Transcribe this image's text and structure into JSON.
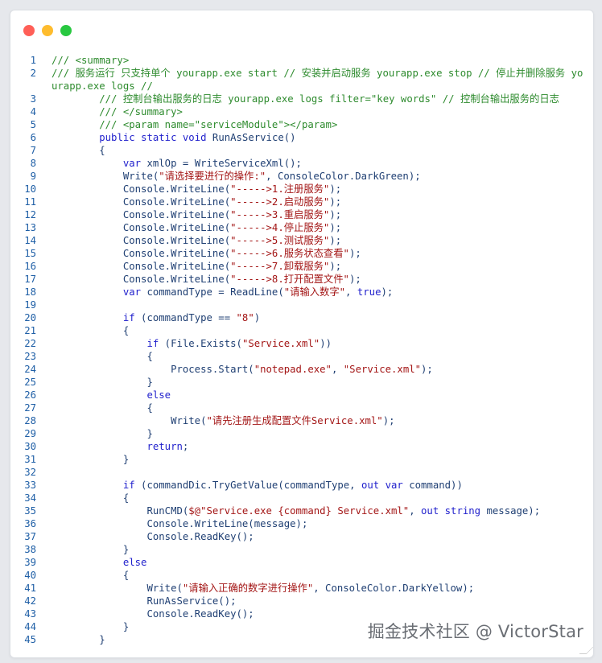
{
  "window": {
    "traffic_lights": [
      {
        "name": "close",
        "color": "#ff5f57"
      },
      {
        "name": "minimize",
        "color": "#febc2e"
      },
      {
        "name": "maximize",
        "color": "#28c840"
      }
    ]
  },
  "code": {
    "lines": [
      {
        "n": "1",
        "text": "/// <summary>"
      },
      {
        "n": "2",
        "text": "        /// 服务运行 只支持单个 yourapp.exe start // 安装并启动服务 yourapp.exe stop // 停止并删除服务 yourapp.exe logs //",
        "wrap": true
      },
      {
        "n": "3",
        "text": "        /// 控制台输出服务的日志 yourapp.exe logs filter=\"key words\" // 控制台输出服务的日志"
      },
      {
        "n": "4",
        "text": "        /// </summary>"
      },
      {
        "n": "5",
        "text": "        /// <param name=\"serviceModule\"></param>"
      },
      {
        "n": "6",
        "text": "        public static void RunAsService()"
      },
      {
        "n": "7",
        "text": "        {"
      },
      {
        "n": "8",
        "text": "            var xmlOp = WriteServiceXml();"
      },
      {
        "n": "9",
        "text": "            Write(\"请选择要进行的操作:\", ConsoleColor.DarkGreen);"
      },
      {
        "n": "10",
        "text": "            Console.WriteLine(\"----->1.注册服务\");"
      },
      {
        "n": "11",
        "text": "            Console.WriteLine(\"----->2.启动服务\");"
      },
      {
        "n": "12",
        "text": "            Console.WriteLine(\"----->3.重启服务\");"
      },
      {
        "n": "13",
        "text": "            Console.WriteLine(\"----->4.停止服务\");"
      },
      {
        "n": "14",
        "text": "            Console.WriteLine(\"----->5.测试服务\");"
      },
      {
        "n": "15",
        "text": "            Console.WriteLine(\"----->6.服务状态查看\");"
      },
      {
        "n": "16",
        "text": "            Console.WriteLine(\"----->7.卸载服务\");"
      },
      {
        "n": "17",
        "text": "            Console.WriteLine(\"----->8.打开配置文件\");"
      },
      {
        "n": "18",
        "text": "            var commandType = ReadLine(\"请输入数字\", true);"
      },
      {
        "n": "19",
        "text": ""
      },
      {
        "n": "20",
        "text": "            if (commandType == \"8\")"
      },
      {
        "n": "21",
        "text": "            {"
      },
      {
        "n": "22",
        "text": "                if (File.Exists(\"Service.xml\"))"
      },
      {
        "n": "23",
        "text": "                {"
      },
      {
        "n": "24",
        "text": "                    Process.Start(\"notepad.exe\", \"Service.xml\");"
      },
      {
        "n": "25",
        "text": "                }"
      },
      {
        "n": "26",
        "text": "                else"
      },
      {
        "n": "27",
        "text": "                {"
      },
      {
        "n": "28",
        "text": "                    Write(\"请先注册生成配置文件Service.xml\");"
      },
      {
        "n": "29",
        "text": "                }"
      },
      {
        "n": "30",
        "text": "                return;"
      },
      {
        "n": "31",
        "text": "            }"
      },
      {
        "n": "32",
        "text": ""
      },
      {
        "n": "33",
        "text": "            if (commandDic.TryGetValue(commandType, out var command))"
      },
      {
        "n": "34",
        "text": "            {"
      },
      {
        "n": "35",
        "text": "                RunCMD($@\"Service.exe {command} Service.xml\", out string message);"
      },
      {
        "n": "36",
        "text": "                Console.WriteLine(message);"
      },
      {
        "n": "37",
        "text": "                Console.ReadKey();"
      },
      {
        "n": "38",
        "text": "            }"
      },
      {
        "n": "39",
        "text": "            else"
      },
      {
        "n": "40",
        "text": "            {"
      },
      {
        "n": "41",
        "text": "                Write(\"请输入正确的数字进行操作\", ConsoleColor.DarkYellow);"
      },
      {
        "n": "42",
        "text": "                RunAsService();"
      },
      {
        "n": "43",
        "text": "                Console.ReadKey();"
      },
      {
        "n": "44",
        "text": "            }"
      },
      {
        "n": "45",
        "text": "        }"
      }
    ]
  },
  "watermark": "掘金技术社区 @ VictorStar",
  "colors": {
    "comment": "#2e8b2e",
    "keyword": "#1f1fcc",
    "string": "#a31515",
    "line_number": "#1f5fa6",
    "identifier": "#1f3f73"
  }
}
